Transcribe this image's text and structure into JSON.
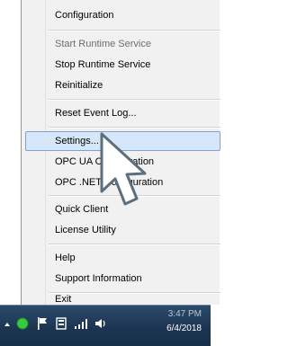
{
  "menu": {
    "items": [
      {
        "label": "Configuration"
      },
      {
        "label": "Start Runtime Service"
      },
      {
        "label": "Stop Runtime Service"
      },
      {
        "label": "Reinitialize"
      },
      {
        "label": "Reset Event Log..."
      },
      {
        "label": "Settings..."
      },
      {
        "label": "OPC UA Configuration"
      },
      {
        "label": "OPC .NET Configuration"
      },
      {
        "label": "Quick Client"
      },
      {
        "label": "License Utility"
      },
      {
        "label": "Help"
      },
      {
        "label": "Support Information"
      },
      {
        "label": "Exit"
      }
    ]
  },
  "taskbar": {
    "time": "3:47 PM",
    "date": "6/4/2018",
    "icons": [
      "show-hidden-icons-arrow",
      "green-status-dot-icon",
      "flag-icon",
      "server-icon",
      "network-signal-icon",
      "speaker-icon"
    ]
  },
  "colors": {
    "menu_background": "#f1f1f1",
    "highlight_background": "#d5e7f8",
    "highlight_border": "#7da2ce",
    "taskbar": "#1c3450"
  }
}
